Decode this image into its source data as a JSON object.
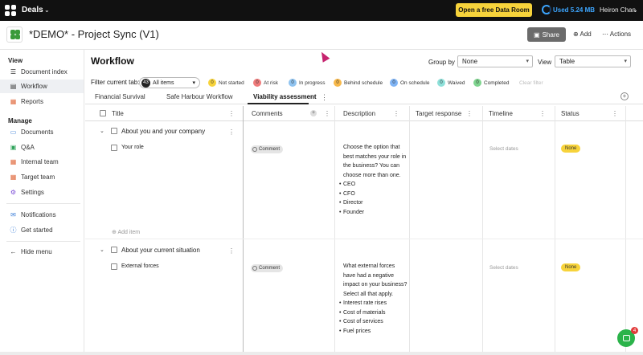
{
  "topbar": {
    "app_name": "Deals",
    "cta_label": "Open a free Data Room",
    "storage_label": "Used 5.24 MB",
    "user_name": "Heiron Chan",
    "storage_color": "#3da6ff",
    "cta_color": "#f7d33b"
  },
  "project": {
    "title": "*DEMO* - Project Sync (V1)",
    "share_label": "Share",
    "add_label": "Add",
    "actions_label": "Actions"
  },
  "sidebar": {
    "view_heading": "View",
    "manage_heading": "Manage",
    "view_items": [
      {
        "label": "Document index",
        "icon": "document-index-icon"
      },
      {
        "label": "Workflow",
        "icon": "workflow-icon"
      },
      {
        "label": "Reports",
        "icon": "reports-icon"
      }
    ],
    "manage_items": [
      {
        "label": "Documents",
        "icon": "documents-icon"
      },
      {
        "label": "Q&A",
        "icon": "qa-icon"
      },
      {
        "label": "Internal team",
        "icon": "internal-team-icon"
      },
      {
        "label": "Target team",
        "icon": "target-team-icon"
      },
      {
        "label": "Settings",
        "icon": "settings-icon"
      }
    ],
    "extra_items": [
      {
        "label": "Notifications",
        "icon": "notifications-icon"
      },
      {
        "label": "Get started",
        "icon": "info-icon"
      }
    ],
    "hide_menu_label": "Hide menu"
  },
  "workflow": {
    "title": "Workflow",
    "group_by_label": "Group by",
    "group_by_value": "None",
    "view_label": "View",
    "view_value": "Table",
    "filter_label": "Filter current tab:",
    "all_items_count": "43",
    "all_items_label": "All items",
    "statuses": [
      {
        "count": "0",
        "label": "Not started",
        "color": "#f7d33b"
      },
      {
        "count": "0",
        "label": "At risk",
        "color": "#ef7b7b"
      },
      {
        "count": "0",
        "label": "In progress",
        "color": "#8fc3f0"
      },
      {
        "count": "0",
        "label": "Behind schedule",
        "color": "#f7b84a"
      },
      {
        "count": "0",
        "label": "On schedule",
        "color": "#7fb4f5"
      },
      {
        "count": "0",
        "label": "Waived",
        "color": "#8ee0d9"
      },
      {
        "count": "0",
        "label": "Completed",
        "color": "#7fd48f"
      }
    ],
    "clear_filter_label": "Clear filter",
    "tabs": [
      "Financial Survival",
      "Safe Harbour Workflow",
      "Viability assessment"
    ],
    "active_tab": "Viability assessment"
  },
  "table": {
    "columns": [
      "Title",
      "Comments",
      "Description",
      "Target response",
      "Timeline",
      "Status"
    ],
    "groups": [
      {
        "title": "About you and your company",
        "rows": [
          {
            "title": "Your role",
            "comment_label": "Comment",
            "description_intro": "Choose the option that best matches your role in the business? You can choose more than one.",
            "description_items": [
              "CEO",
              "CFO",
              "Director",
              "Founder"
            ],
            "timeline": "Select dates",
            "status": "None"
          }
        ],
        "add_item_label": "Add item"
      },
      {
        "title": "About your current situation",
        "rows": [
          {
            "title": "External forces",
            "comment_label": "Comment",
            "description_intro": "What external forces have had a negative impact on your business? Select all that apply.",
            "description_items": [
              "Interest rate rises",
              "Cost of materials",
              "Cost of services",
              "Fuel prices"
            ],
            "timeline": "Select dates",
            "status": "None"
          }
        ]
      }
    ]
  },
  "intercom": {
    "badge_count": "4"
  }
}
